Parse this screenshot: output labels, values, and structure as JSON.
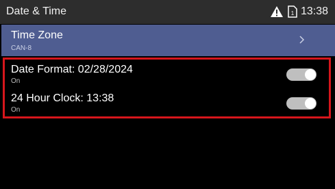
{
  "status_bar": {
    "title": "Date & Time",
    "time": "13:38",
    "icons": [
      "warning-icon",
      "sim-card-icon"
    ]
  },
  "settings": {
    "time_zone": {
      "label": "Time Zone",
      "value": "CAN-8"
    },
    "date_format": {
      "label": "Date Format: 02/28/2024",
      "state": "On"
    },
    "clock_24h": {
      "label": "24 Hour Clock: 13:38",
      "state": "On"
    }
  },
  "colors": {
    "status_bar_bg": "#2d2d2d",
    "selected_row_bg": "#4f5d91",
    "highlight_border": "#d7161c",
    "toggle_track": "#bfbfbf"
  }
}
